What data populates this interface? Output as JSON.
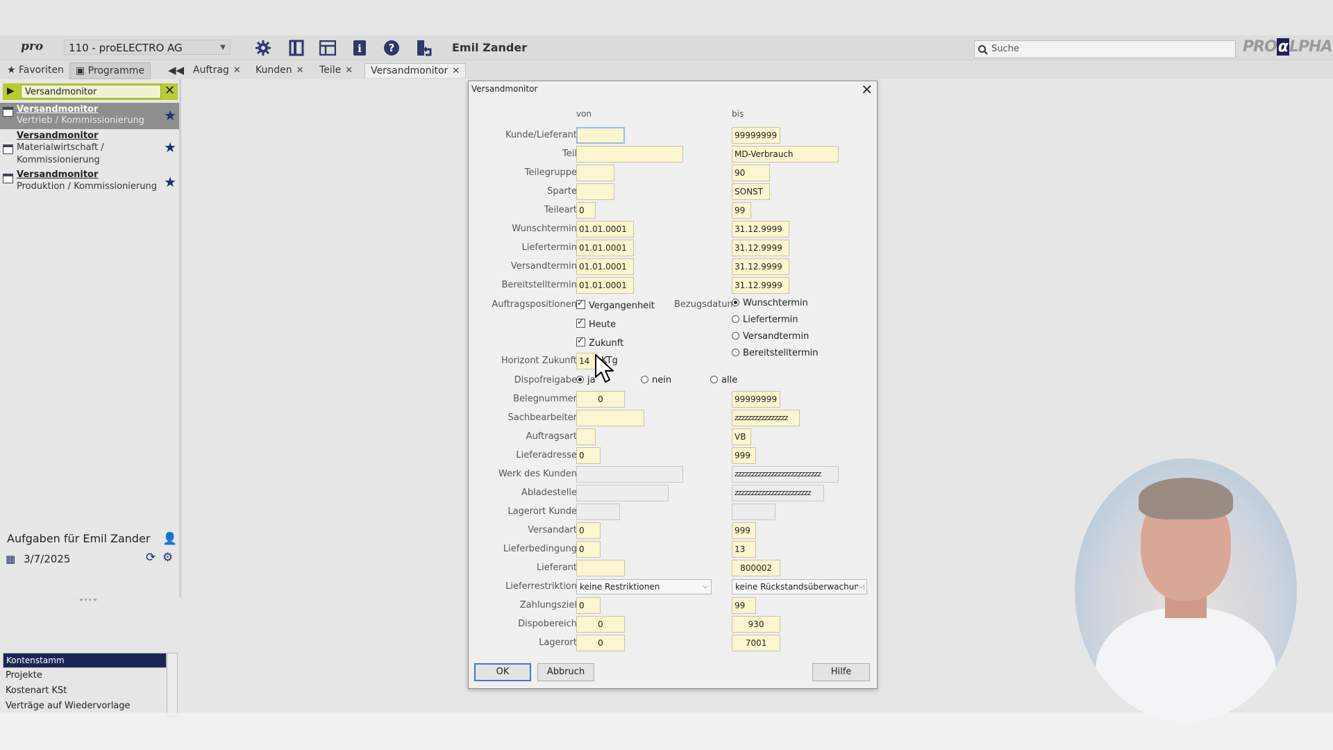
{
  "topbar": {
    "logo": "pro",
    "company": "110 - proELECTRO AG",
    "user": "Emil Zander",
    "search_placeholder": "Suche",
    "brand_pre": "PRO",
    "brand_alpha": "α",
    "brand_post": "LPHA"
  },
  "nav": {
    "favoriten": "Favoriten",
    "programme": "Programme",
    "tabs": [
      "Auftrag",
      "Kunden",
      "Teile",
      "Versandmonitor"
    ]
  },
  "left": {
    "search_value": "Versandmonitor",
    "programs": [
      {
        "title": "Versandmonitor",
        "sub": "Vertrieb / Kommissionierung"
      },
      {
        "title": "Versandmonitor",
        "sub": "Materialwirtschaft / Kommissionierung",
        "sub1": "Materialwirtschaft /",
        "sub2": "Kommissionierung"
      },
      {
        "title": "Versandmonitor",
        "sub": "Produktion / Kommissionierung"
      }
    ],
    "tasks_title": "Aufgaben für Emil Zander",
    "task_date": "3/7/2025",
    "task_items": [
      "Kontenstamm",
      "Projekte",
      "Kostenart KSt",
      "Verträge auf Wiedervorlage"
    ]
  },
  "dialog": {
    "title": "Versandmonitor",
    "von": "von",
    "bis": "bis",
    "labels": {
      "kunde": "Kunde/Lieferant",
      "teil": "Teil",
      "teilegruppe": "Teilegruppe",
      "sparte": "Sparte",
      "teileart": "Teileart",
      "wunschtermin": "Wunschtermin",
      "liefertermin": "Liefertermin",
      "versandtermin": "Versandtermin",
      "bereitstelltermin": "Bereitstelltermin",
      "auftragspositionen": "Auftragspositionen",
      "bezugsdatum": "Bezugsdatum",
      "horizont": "Horizont Zukunft",
      "dispofreigabe": "Dispofreigabe",
      "belegnummer": "Belegnummer",
      "sachbearbeiter": "Sachbearbeiter",
      "auftragsart": "Auftragsart",
      "lieferadresse": "Lieferadresse",
      "werk": "Werk des Kunden",
      "abladestelle": "Abladestelle",
      "lagerort_kunde": "Lagerort Kunde",
      "versandart": "Versandart",
      "lieferbedingung": "Lieferbedingung",
      "lieferant": "Lieferant",
      "lieferrestriktion": "Lieferrestriktion",
      "zahlungsziel": "Zahlungsziel",
      "dispobereich": "Dispobereich",
      "lagerort": "Lagerort"
    },
    "von_values": {
      "kunde": "",
      "teil": "",
      "teilegruppe": "",
      "sparte": "",
      "teileart": "0",
      "wunschtermin": "01.01.0001",
      "liefertermin": "01.01.0001",
      "versandtermin": "01.01.0001",
      "bereitstelltermin": "01.01.0001",
      "horizont": "14",
      "belegnummer": "0",
      "sachbearbeiter": "",
      "auftragsart": "",
      "lieferadresse": "0",
      "werk": "",
      "abladestelle": "",
      "lagerort_kunde": "",
      "versandart": "0",
      "lieferbedingung": "0",
      "lieferant": "",
      "zahlungsziel": "0",
      "dispobereich": "0",
      "lagerort": "0"
    },
    "bis_values": {
      "kunde": "99999999",
      "teil": "MD-Verbrauch",
      "teilegruppe": "90",
      "sparte": "SONST",
      "teileart": "99",
      "wunschtermin": "31.12.9999",
      "liefertermin": "31.12.9999",
      "versandtermin": "31.12.9999",
      "bereitstelltermin": "31.12.9999",
      "belegnummer": "99999999",
      "sachbearbeiter": "zzzzzzzzzzzzzzzz",
      "auftragsart": "VB",
      "lieferadresse": "999",
      "werk": "zzzzzzzzzzzzzzzzzzzzzzzzzz",
      "abladestelle": "zzzzzzzzzzzzzzzzzzzzzzz",
      "lagerort_kunde": "",
      "versandart": "999",
      "lieferbedingung": "13",
      "lieferant": "800002",
      "zahlungsziel": "99",
      "dispobereich": "930",
      "lagerort": "7001"
    },
    "ktg": "KTg",
    "checks": {
      "vergangenheit": "Vergangenheit",
      "heute": "Heute",
      "zukunft": "Zukunft"
    },
    "bezug_options": [
      "Wunschtermin",
      "Liefertermin",
      "Versandtermin",
      "Bereitstelltermin"
    ],
    "dispo_options": [
      "ja",
      "nein",
      "alle"
    ],
    "lieferrestriktion_von": "keine Restriktionen",
    "lieferrestriktion_bis": "keine Rückstandsüberwachung",
    "buttons": {
      "ok": "OK",
      "abbruch": "Abbruch",
      "hilfe": "Hilfe"
    }
  }
}
